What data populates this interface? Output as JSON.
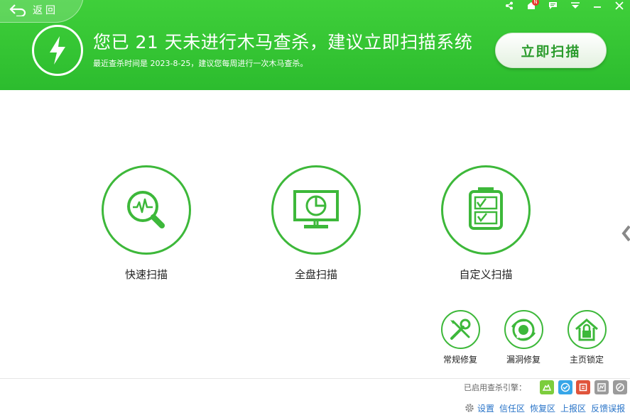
{
  "header": {
    "back_label": "返回",
    "title": "您已 21 天未进行木马查杀，建议立即扫描系统",
    "subtitle": "最近查杀时间是 2023-8-25，建议您每周进行一次木马查杀。",
    "scan_button": "立即扫描",
    "badge": "N",
    "icons": [
      "share-icon",
      "skin-icon",
      "feedback-icon",
      "menu-icon",
      "minimize-icon",
      "close-icon"
    ]
  },
  "modes": [
    {
      "label": "快速扫描",
      "icon": "quick-scan-icon"
    },
    {
      "label": "全盘扫描",
      "icon": "full-scan-icon"
    },
    {
      "label": "自定义扫描",
      "icon": "custom-scan-icon"
    }
  ],
  "tools": [
    {
      "label": "常规修复",
      "icon": "repair-tools-icon"
    },
    {
      "label": "漏洞修复",
      "icon": "vulnerability-fix-icon"
    },
    {
      "label": "主页锁定",
      "icon": "homepage-lock-icon"
    }
  ],
  "footer": {
    "engines_label": "已启用查杀引擎：",
    "engines": [
      {
        "name": "cloud-engine",
        "color": "#7ccd3c",
        "active": true
      },
      {
        "name": "qvm-engine",
        "color": "#36a6e8",
        "active": true
      },
      {
        "name": "qex-engine",
        "color": "#e0543b",
        "active": true
      },
      {
        "name": "avira-engine",
        "color": "#9b9b9b",
        "active": false
      },
      {
        "name": "bitdefender-engine",
        "color": "#9b9b9b",
        "active": false
      }
    ],
    "links": [
      "设置",
      "信任区",
      "恢复区",
      "上报区",
      "反馈误报"
    ]
  },
  "colors": {
    "primary": "#2cbc2e",
    "accent": "#3db83a",
    "link": "#2773c8"
  }
}
